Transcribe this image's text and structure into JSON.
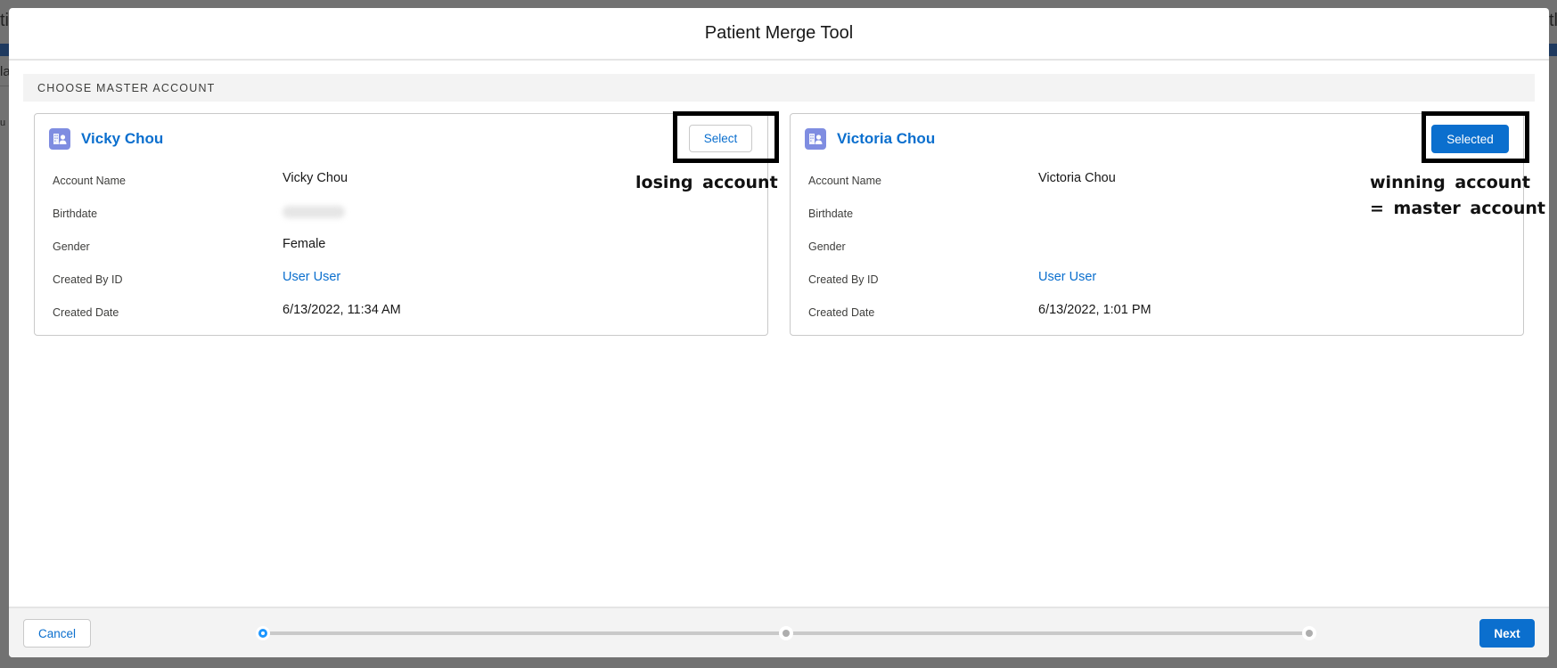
{
  "background": {
    "fragments": [
      "ti",
      "la",
      "u",
      "tl"
    ]
  },
  "modal": {
    "title": "Patient Merge Tool",
    "section_title": "CHOOSE MASTER ACCOUNT",
    "accounts": [
      {
        "name": "Vicky Chou",
        "icon": "account-icon",
        "button_label": "Select",
        "selected": false,
        "fields": [
          {
            "label": "Account Name",
            "value": "Vicky Chou",
            "type": "text"
          },
          {
            "label": "Birthdate",
            "value": "",
            "type": "blurred"
          },
          {
            "label": "Gender",
            "value": "Female",
            "type": "text"
          },
          {
            "label": "Created By ID",
            "value": "User User",
            "type": "link"
          },
          {
            "label": "Created Date",
            "value": "6/13/2022, 11:34 AM",
            "type": "text"
          }
        ],
        "annotation": [
          "losing account"
        ]
      },
      {
        "name": "Victoria Chou",
        "icon": "account-icon",
        "button_label": "Selected",
        "selected": true,
        "fields": [
          {
            "label": "Account Name",
            "value": "Victoria Chou",
            "type": "text"
          },
          {
            "label": "Birthdate",
            "value": "",
            "type": "text"
          },
          {
            "label": "Gender",
            "value": "",
            "type": "text"
          },
          {
            "label": "Created By ID",
            "value": "User User",
            "type": "link"
          },
          {
            "label": "Created Date",
            "value": "6/13/2022, 1:01 PM",
            "type": "text"
          }
        ],
        "annotation": [
          "winning account",
          "= master account"
        ]
      }
    ],
    "footer": {
      "cancel_label": "Cancel",
      "next_label": "Next",
      "progress": {
        "current_step": 1,
        "total_steps": 3
      }
    }
  },
  "colors": {
    "brand": "#0b6fce",
    "progress_active": "#1b96ff",
    "account_icon_bg": "#7f8de1"
  }
}
